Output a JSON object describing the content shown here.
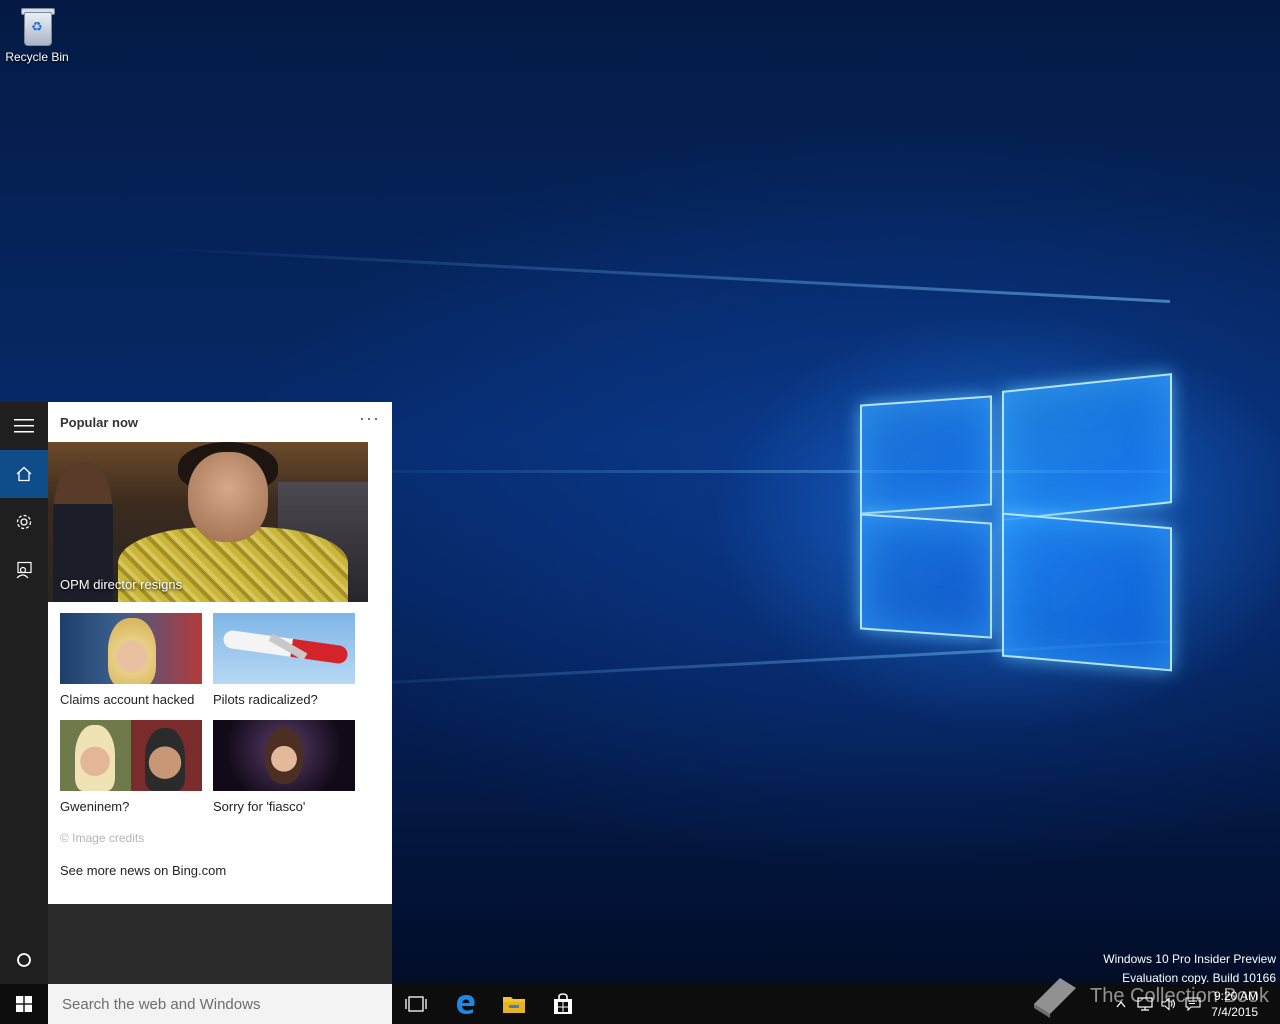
{
  "desktop": {
    "icons": [
      {
        "label": "Recycle Bin",
        "icon": "recycle-bin-icon"
      }
    ]
  },
  "watermark": {
    "line1": "Windows 10 Pro Insider Preview",
    "line2": "Evaluation copy. Build 10166"
  },
  "cortana": {
    "rail": {
      "items": [
        {
          "icon": "hamburger-menu-icon"
        },
        {
          "icon": "home-icon",
          "active": true
        },
        {
          "icon": "gear-icon"
        },
        {
          "icon": "feedback-icon"
        },
        {
          "icon": "cortana-circle-icon"
        }
      ]
    },
    "header": "Popular now",
    "more": "···",
    "hero": {
      "caption": "OPM director resigns"
    },
    "tiles": [
      {
        "caption": "Claims account hacked"
      },
      {
        "caption": "Pilots radicalized?"
      },
      {
        "caption": "Gweninem?"
      },
      {
        "caption": "Sorry for 'fiasco'"
      }
    ],
    "credits": "© Image credits",
    "bing_link": "See more news on Bing.com"
  },
  "taskbar": {
    "search_placeholder": "Search the web and Windows",
    "apps": [
      "task-view-icon",
      "edge-icon",
      "file-explorer-icon",
      "store-icon"
    ],
    "clock": {
      "time": "9:20 AM",
      "date": "7/4/2015"
    },
    "brand": "The Collection Book"
  },
  "colors": {
    "rail_bg": "#1f1f1f",
    "rail_active": "#0f4d8a",
    "taskbar_bg": "#0d0d0d",
    "accent": "#0078d7"
  }
}
